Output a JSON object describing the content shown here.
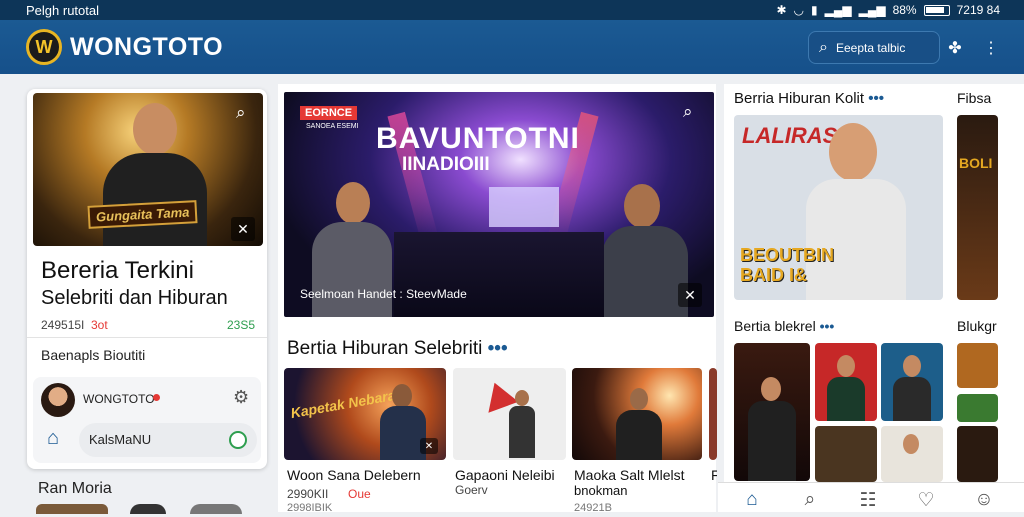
{
  "status_bar": {
    "carrier": "Pelgh rutotal",
    "battery": "88%",
    "time": "7219 84"
  },
  "app": {
    "brand": "WONGTOTO",
    "logo_letter": "W",
    "search_label": "Eeepta talbic"
  },
  "left_card": {
    "headline_line1": "Bereria Terkini",
    "headline_line2": "Selebriti dan Hiburan",
    "meta_count": "249515I",
    "meta_tag": "3ot",
    "meta_right": "23S5",
    "thumb_banner": "Gungaita Tama",
    "subtitle": "Baenapls Bioutiti",
    "user_name": "WONGTOTO",
    "menu_label": "KalsMaNU"
  },
  "left_bottom": {
    "label": "Ran Moria"
  },
  "hero": {
    "badge_top": "EORNCE",
    "badge_sub": "SANOEA ESEMI",
    "title_line1": "BAVUNTOTNI",
    "title_line2": "IINADIOIII",
    "caption": "Seelmoan Handet : SteevMade"
  },
  "section_center": {
    "title": "Bertia Hiburan Selebriti",
    "items": [
      {
        "title": "Woon Sana Delebern",
        "meta": "2990KII",
        "tag": "Oue",
        "sub": "",
        "banner": "Kapetak Nebara"
      },
      {
        "title": "Gapaoni Neleibi",
        "meta": "Goerv",
        "tag": "",
        "sub": "",
        "banner": ""
      },
      {
        "title": "Maoka Salt Mlelst",
        "meta": "",
        "tag": "",
        "sub": "bnokman",
        "banner": ""
      },
      {
        "title": "Fi",
        "meta": "",
        "tag": "",
        "sub": "",
        "banner": ""
      }
    ],
    "row_bottom": [
      "2998IBIK",
      "24921B"
    ]
  },
  "right_top": {
    "title": "Berria Hiburan Kolit",
    "next_title": "Fibsa",
    "poster_top": "LALIRAS",
    "poster_bottom": "BEOUTBIN BAID I&",
    "side_poster": "BOLI"
  },
  "right_mid": {
    "title": "Bertia blekrel",
    "next_title": "Blukgr"
  },
  "bottom_nav": [
    {
      "name": "home",
      "icon": "⌂",
      "active": true
    },
    {
      "name": "search",
      "icon": "⌕",
      "active": false
    },
    {
      "name": "news",
      "icon": "☷",
      "active": false
    },
    {
      "name": "bookmark",
      "icon": "♡",
      "active": false
    },
    {
      "name": "profile",
      "icon": "☺",
      "active": false
    }
  ],
  "colors": {
    "brand_blue": "#16508a",
    "accent_red": "#e53935",
    "accent_green": "#2e9e4f"
  }
}
